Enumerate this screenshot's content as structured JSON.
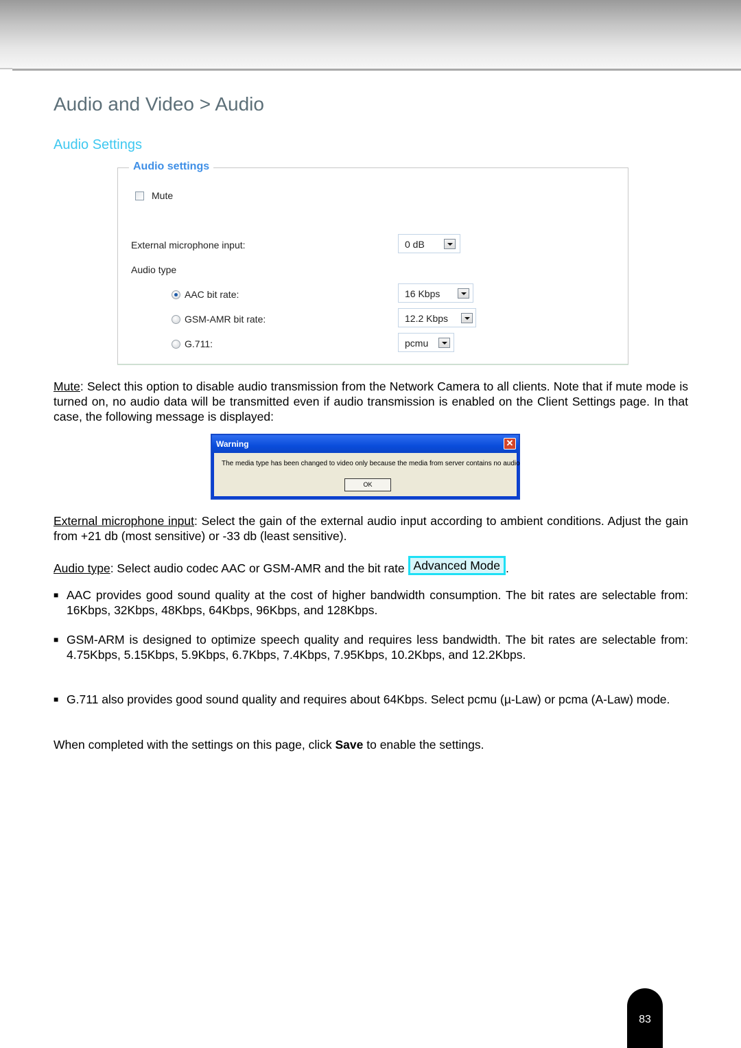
{
  "page": {
    "title": "Audio and Video > Audio",
    "section_title": "Audio Settings",
    "page_number": "83"
  },
  "panel": {
    "legend": "Audio settings",
    "mute_label": "Mute",
    "mute_checked": false,
    "ext_mic_label": "External microphone input:",
    "ext_mic_value": "0 dB",
    "audio_type_label": "Audio type",
    "options": [
      {
        "label": "AAC bit rate:",
        "selected": true,
        "value": "16 Kbps"
      },
      {
        "label": "GSM-AMR bit rate:",
        "selected": false,
        "value": "12.2 Kbps"
      },
      {
        "label": "G.711:",
        "selected": false,
        "value": "pcmu"
      }
    ]
  },
  "paragraphs": {
    "mute_term": "Mute",
    "mute_text": ": Select this option to disable audio transmission from the Network Camera to all clients. Note that if mute mode is turned on, no audio data will be transmitted even if audio transmission is enabled on the Client Settings page. In that case, the following message is displayed:",
    "ext_term": "External microphone input",
    "ext_text": ": Select the gain of the external audio input according to ambient conditions. Adjust the gain from +21 db (most sensitive) or -33 db (least sensitive).",
    "type_term": "Audio type",
    "type_text": ": Select audio codec AAC or GSM-AMR and the bit rate ",
    "advanced_mode": "Advanced Mode",
    "type_end": ".",
    "bullets": [
      "AAC provides good sound quality at the cost of higher bandwidth consumption. The bit rates are selectable from: 16Kbps, 32Kbps, 48Kbps, 64Kbps, 96Kbps, and 128Kbps.",
      "GSM-ARM is designed to optimize speech quality and requires less bandwidth. The bit rates are selectable from: 4.75Kbps, 5.15Kbps, 5.9Kbps, 6.7Kbps, 7.4Kbps, 7.95Kbps, 10.2Kbps, and 12.2Kbps.",
      "G.711 also provides good sound quality and requires about 64Kbps. Select pcmu (µ-Law) or pcma (A-Law) mode."
    ],
    "bullet_mark": "■",
    "save_pre": "When completed with the settings on this page, click ",
    "save_word": "Save",
    "save_post": " to enable the settings."
  },
  "dialog": {
    "title": "Warning",
    "close_glyph": "✕",
    "message": "The media type has been changed to video only because the media from server contains no audio",
    "ok_label": "OK"
  }
}
